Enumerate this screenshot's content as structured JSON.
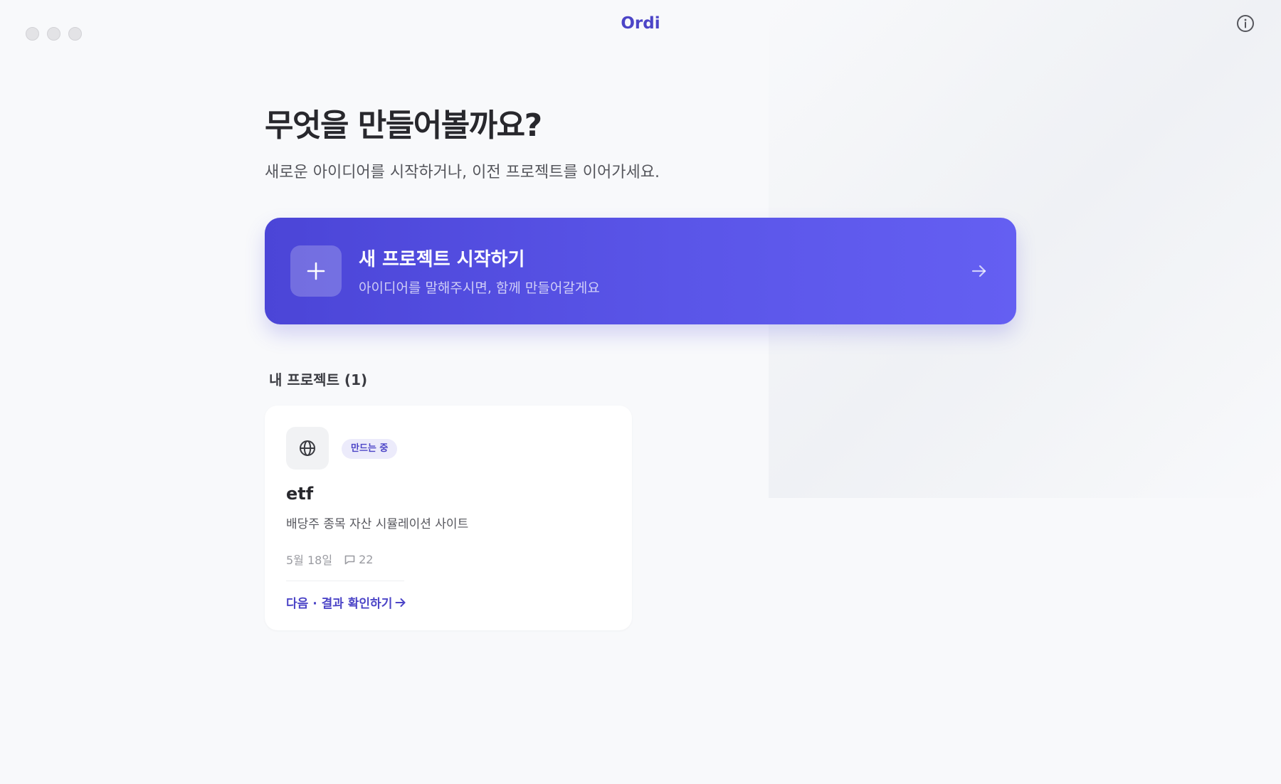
{
  "app": {
    "title": "Ordi"
  },
  "header": {
    "title": "무엇을 만들어볼까요?",
    "subtitle": "새로운 아이디어를 시작하거나, 이전 프로젝트를 이어가세요."
  },
  "new_project": {
    "title": "새 프로젝트 시작하기",
    "description": "아이디어를 말해주시면, 함께 만들어갈게요"
  },
  "projects": {
    "section_title": "내 프로젝트 (1)",
    "items": [
      {
        "status": "만드는 중",
        "name": "etf",
        "description": "배당주 종목 자산 시뮬레이션 사이트",
        "date": "5월 18일",
        "message_count": "22",
        "action": "다음 · 결과 확인하기",
        "icon": "globe-icon"
      }
    ]
  },
  "colors": {
    "accent": "#4c45c7",
    "button_gradient_start": "#4b45d7",
    "button_gradient_end": "#645ff2",
    "badge_bg": "#ecebfb",
    "background": "#f8f9fb"
  },
  "icons": {
    "info": "info-icon",
    "plus": "plus-icon",
    "arrow": "arrow-right-icon",
    "message": "message-icon"
  }
}
